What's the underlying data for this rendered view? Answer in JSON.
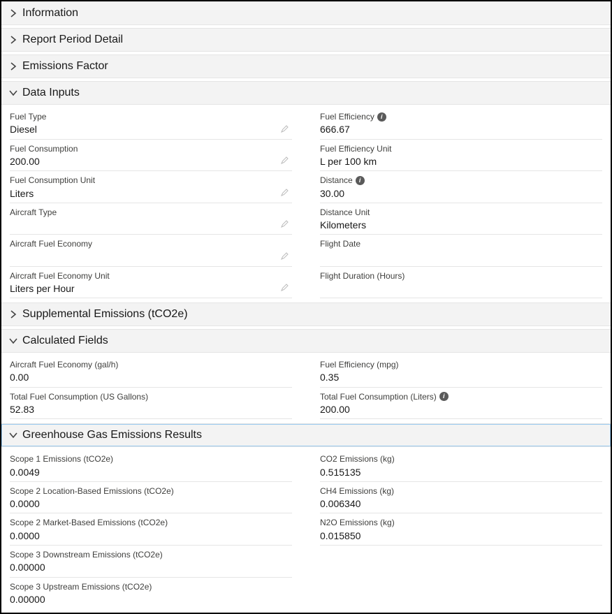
{
  "sections": {
    "information": {
      "title": "Information"
    },
    "reportPeriodDetail": {
      "title": "Report Period Detail"
    },
    "emissionsFactor": {
      "title": "Emissions Factor"
    },
    "dataInputs": {
      "title": "Data Inputs",
      "left": {
        "fuelType": {
          "label": "Fuel Type",
          "value": "Diesel"
        },
        "fuelConsumption": {
          "label": "Fuel Consumption",
          "value": "200.00"
        },
        "fuelConsumptionUnit": {
          "label": "Fuel Consumption Unit",
          "value": "Liters"
        },
        "aircraftType": {
          "label": "Aircraft Type",
          "value": ""
        },
        "aircraftFuelEconomy": {
          "label": "Aircraft Fuel Economy",
          "value": ""
        },
        "aircraftFuelEconomyUnit": {
          "label": "Aircraft Fuel Economy Unit",
          "value": "Liters per Hour"
        }
      },
      "right": {
        "fuelEfficiency": {
          "label": "Fuel Efficiency",
          "value": "666.67"
        },
        "fuelEfficiencyUnit": {
          "label": "Fuel Efficiency Unit",
          "value": "L per 100 km"
        },
        "distance": {
          "label": "Distance",
          "value": "30.00"
        },
        "distanceUnit": {
          "label": "Distance Unit",
          "value": "Kilometers"
        },
        "flightDate": {
          "label": "Flight Date",
          "value": ""
        },
        "flightDuration": {
          "label": "Flight Duration (Hours)",
          "value": ""
        }
      }
    },
    "supplementalEmissions": {
      "title": "Supplemental Emissions (tCO2e)"
    },
    "calculatedFields": {
      "title": "Calculated Fields",
      "left": {
        "aircraftFuelEconomyGalH": {
          "label": "Aircraft Fuel Economy (gal/h)",
          "value": "0.00"
        },
        "totalFuelConsumptionUSGallons": {
          "label": "Total Fuel Consumption (US Gallons)",
          "value": "52.83"
        }
      },
      "right": {
        "fuelEfficiencyMpg": {
          "label": "Fuel Efficiency (mpg)",
          "value": "0.35"
        },
        "totalFuelConsumptionLiters": {
          "label": "Total Fuel Consumption (Liters)",
          "value": "200.00"
        }
      }
    },
    "ghgResults": {
      "title": "Greenhouse Gas Emissions Results",
      "left": {
        "scope1": {
          "label": "Scope 1 Emissions (tCO2e)",
          "value": "0.0049"
        },
        "scope2Location": {
          "label": "Scope 2 Location-Based Emissions (tCO2e)",
          "value": "0.0000"
        },
        "scope2Market": {
          "label": "Scope 2 Market-Based Emissions (tCO2e)",
          "value": "0.0000"
        },
        "scope3Downstream": {
          "label": "Scope 3 Downstream Emissions (tCO2e)",
          "value": "0.00000"
        },
        "scope3Upstream": {
          "label": "Scope 3 Upstream Emissions (tCO2e)",
          "value": "0.00000"
        }
      },
      "right": {
        "co2": {
          "label": "CO2 Emissions (kg)",
          "value": "0.515135"
        },
        "ch4": {
          "label": "CH4 Emissions (kg)",
          "value": "0.006340"
        },
        "n2o": {
          "label": "N2O Emissions (kg)",
          "value": "0.015850"
        }
      }
    }
  }
}
